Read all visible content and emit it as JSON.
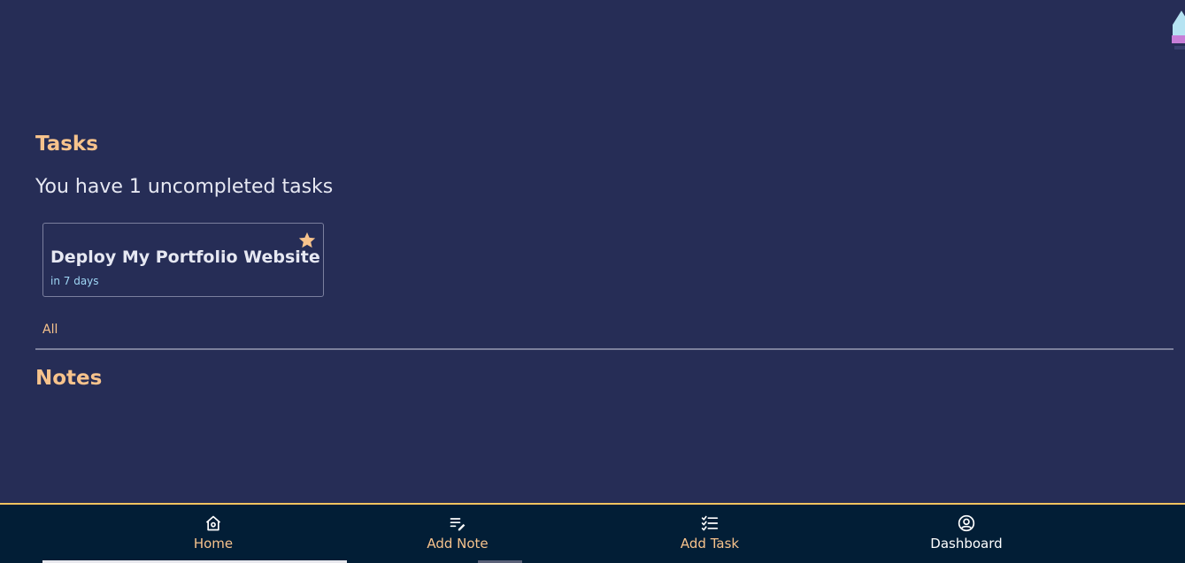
{
  "tasks": {
    "title": "Tasks",
    "summary": "You have 1 uncompleted tasks",
    "items": [
      {
        "title": "Deploy My Portfolio Website",
        "due": "in 7 days",
        "starred": true
      }
    ],
    "filter_label": "All"
  },
  "notes": {
    "title": "Notes"
  },
  "nav": {
    "home": "Home",
    "add_note": "Add Note",
    "add_task": "Add Task",
    "dashboard": "Dashboard"
  },
  "colors": {
    "background": "#262d56",
    "accent": "#f7c38c",
    "nav_background": "#021e36",
    "nav_border": "#f2c460",
    "due_text": "#9fd7f5"
  },
  "icons": {
    "logo": "pen-nib-logo",
    "star": "star-icon",
    "home": "home-icon",
    "add_note": "edit-note-icon",
    "add_task": "checklist-icon",
    "dashboard": "account-circle-icon"
  }
}
